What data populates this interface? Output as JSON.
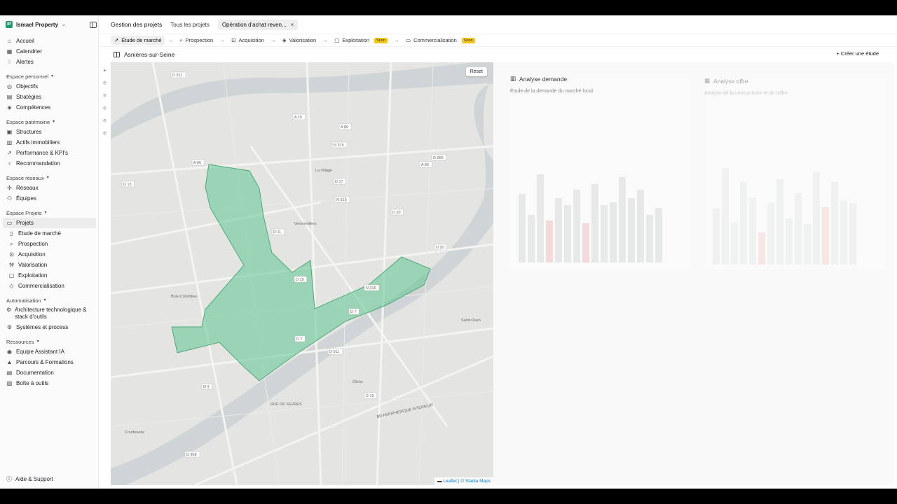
{
  "sidebar": {
    "brand_initials": "IP",
    "brand": "Ismael Property",
    "items_top": [
      {
        "icon": "home-icon",
        "label": "Accueil"
      },
      {
        "icon": "calendar-icon",
        "label": "Calendrier"
      },
      {
        "icon": "bell-icon",
        "label": "Alertes"
      }
    ],
    "sections": [
      {
        "title": "Espace personnel",
        "items": [
          {
            "icon": "target-icon",
            "label": "Objectifs"
          },
          {
            "icon": "book-icon",
            "label": "Stratégies"
          },
          {
            "icon": "layers-icon",
            "label": "Compétences"
          }
        ]
      },
      {
        "title": "Espace patrimoine",
        "items": [
          {
            "icon": "grid-icon",
            "label": "Structures"
          },
          {
            "icon": "building-icon",
            "label": "Actifs immobiliers"
          },
          {
            "icon": "trend-icon",
            "label": "Performance & KPI's"
          },
          {
            "icon": "bulb-icon",
            "label": "Recommandation"
          }
        ]
      },
      {
        "title": "Espace réseaux",
        "items": [
          {
            "icon": "network-icon",
            "label": "Réseaux"
          },
          {
            "icon": "users-icon",
            "label": "Équipes"
          }
        ]
      },
      {
        "title": "Espace Projets",
        "items": [
          {
            "icon": "folder-icon",
            "label": "Projets",
            "active": true
          },
          {
            "icon": "chart-icon",
            "label": "Etude de marché",
            "sub": true
          },
          {
            "icon": "search-icon",
            "label": "Prospection",
            "sub": true
          },
          {
            "icon": "cart-icon",
            "label": "Acquisition",
            "sub": true
          },
          {
            "icon": "hammer-icon",
            "label": "Valorisation",
            "sub": true
          },
          {
            "icon": "doc-icon",
            "label": "Exploitation",
            "sub": true
          },
          {
            "icon": "tag-icon",
            "label": "Commercialisation",
            "sub": true
          }
        ]
      },
      {
        "title": "Automatisation",
        "items": [
          {
            "icon": "gear-icon",
            "label": "Architecture technologique & stack d'outils"
          },
          {
            "icon": "cog-icon",
            "label": "Systèmes et process"
          }
        ]
      },
      {
        "title": "Ressources",
        "items": [
          {
            "icon": "robot-icon",
            "label": "Equipe Assistant IA"
          },
          {
            "icon": "grad-icon",
            "label": "Parcours & Formations"
          },
          {
            "icon": "book-icon",
            "label": "Documentation"
          },
          {
            "icon": "box-icon",
            "label": "Boîte à outils"
          }
        ]
      }
    ],
    "help": "Aide & Support"
  },
  "tabs": {
    "title": "Gestion des projets",
    "all": "Tous les projets",
    "active": "Opération d'achat reven..."
  },
  "steps": [
    {
      "label": "Étude de marché",
      "active": true,
      "soon": false
    },
    {
      "label": "Prospection",
      "soon": false
    },
    {
      "label": "Acquisition",
      "soon": false
    },
    {
      "label": "Valorisation",
      "soon": false
    },
    {
      "label": "Exploitation",
      "soon": true
    },
    {
      "label": "Commercialisation",
      "soon": true
    }
  ],
  "soon_label": "Soon",
  "location": "Asnières-sur-Seine",
  "create_label": "Créer une étude",
  "map": {
    "reset": "Reset",
    "attribution_leaflet": "Leaflet",
    "attribution_sep": " | © ",
    "attribution_stadia": "Stadia Maps",
    "labels": [
      "D 311",
      "A 15",
      "A 86",
      "N 315",
      "D 966",
      "A 86",
      "A 86",
      "D 13",
      "D 17",
      "N 315",
      "D 20",
      "D 11",
      "Gennevilliers",
      "La Village",
      "D 20",
      "D 19",
      "N 315",
      "D 7",
      "Bois-Colombes",
      "D 911",
      "D 7",
      "D 9",
      "Clichy",
      "D 19",
      "Courbevoie",
      "D 908",
      "BD PERIPHERIQUE INTERIEUR",
      "RUE DE SEVRES",
      "Saint-Ouen"
    ],
    "zone_color": "#5fc592"
  },
  "cards": [
    {
      "title": "Analyse demande",
      "subtitle": "Étude de la demande du marché local"
    },
    {
      "title": "Analyse offre",
      "subtitle": "Analyse de la concurrence et de l'offre"
    }
  ]
}
